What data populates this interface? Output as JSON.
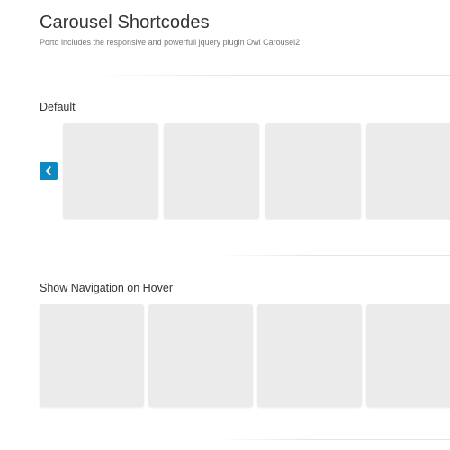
{
  "header": {
    "title": "Carousel Shortcodes",
    "subtitle": "Porto includes the responsive and powerfull jquery plugin Owl Carousel2."
  },
  "sections": [
    {
      "heading": "Default",
      "nav": {
        "prev_icon": "chevron-left-icon"
      },
      "items": 4
    },
    {
      "heading": "Show Navigation on Hover",
      "items": 4
    }
  ],
  "colors": {
    "accent": "#0d88c1",
    "tile": "#ebebeb",
    "text": "#333333",
    "muted": "#777777"
  }
}
